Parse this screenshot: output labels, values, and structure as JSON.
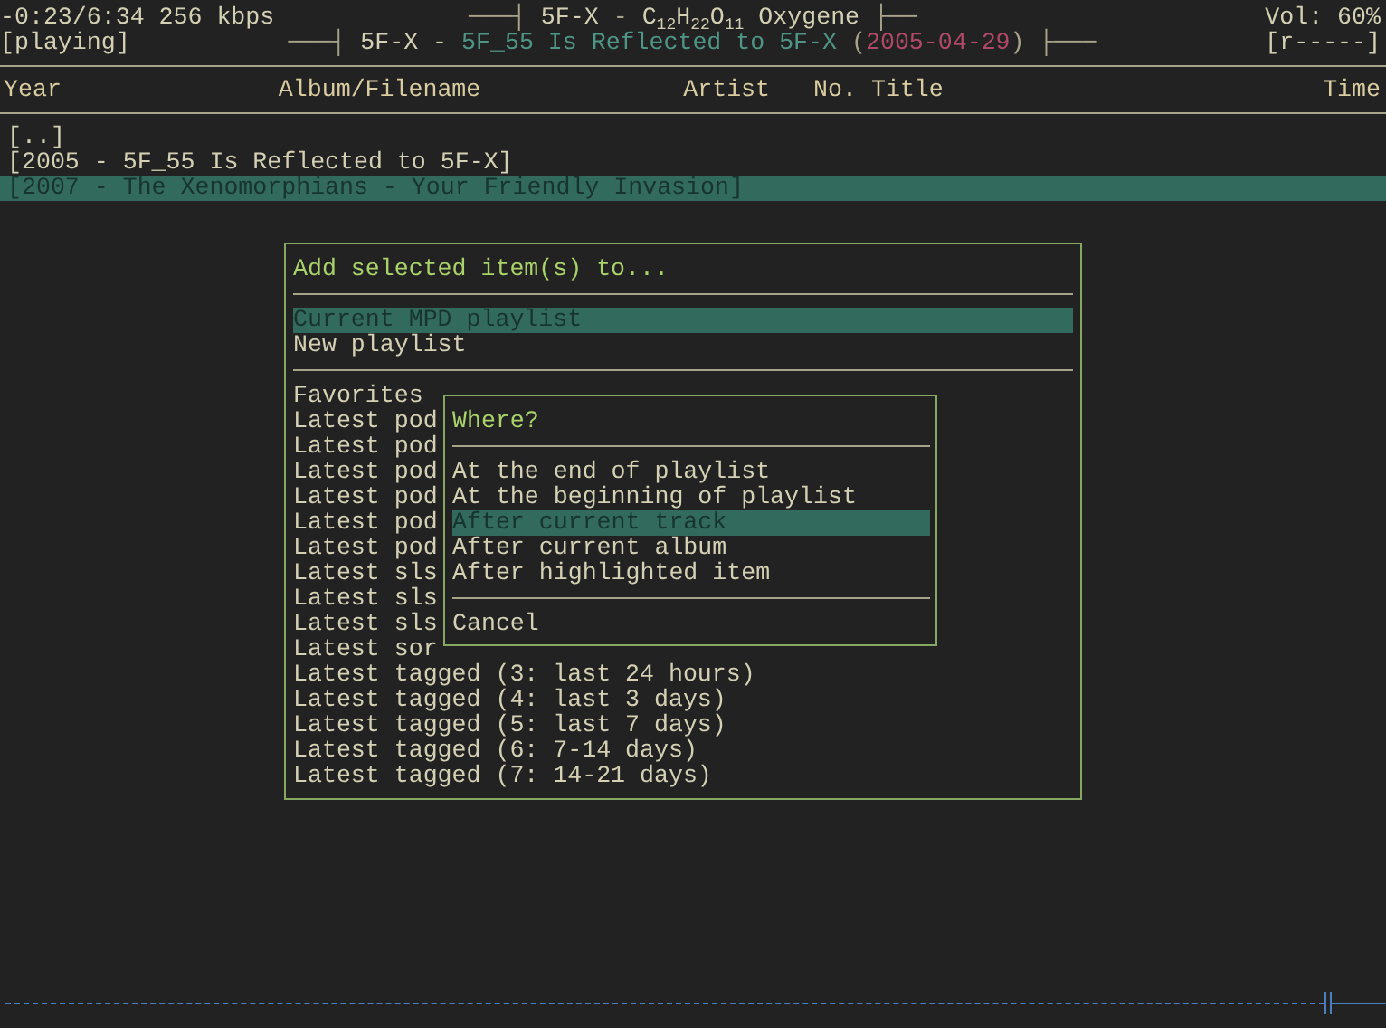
{
  "status": {
    "time": "-0:23/6:34 256 kbps",
    "state": "[playing]",
    "volume": "Vol: 60%",
    "flags": "[r-----]"
  },
  "now_playing": [
    [
      {
        "text": "───┤",
        "kind": "frame"
      },
      {
        "text": "5F-X",
        "kind": "plain"
      },
      {
        "text": "-",
        "kind": "frame"
      },
      {
        "text": "C$_{12}$H$_{22}$O$_{11}$ Oxygene",
        "kind": "plain"
      },
      {
        "text": "├──",
        "kind": "frame"
      }
    ],
    [
      {
        "text": "───┤",
        "kind": "frame"
      },
      {
        "text": "5F-X",
        "kind": "plain"
      },
      {
        "text": "-",
        "kind": "plain"
      },
      {
        "text": "5F_55 Is Reflected to 5F-X",
        "kind": "album"
      },
      {
        "text": "2005-04-29",
        "open": "(",
        "close": ")",
        "kind": "date"
      },
      {
        "text": "├───",
        "kind": "frame"
      }
    ]
  ],
  "columns": [
    "Year",
    "Album/Filename",
    "Artist",
    "No.",
    "Title",
    "Time"
  ],
  "rows": [
    {
      "label": "[..]",
      "selected": false
    },
    {
      "label": "[2005 - 5F_55 Is Reflected to 5F-X]",
      "selected": false
    },
    {
      "label": "[2007 - The Xenomorphians - Your Friendly Invasion]",
      "selected": true
    }
  ],
  "dialog": {
    "title": "Add selected item(s) to...",
    "targets": [
      {
        "label": "Current MPD playlist",
        "selected": true
      },
      {
        "label": "New playlist",
        "selected": false
      }
    ],
    "playlists": [
      "Favorites",
      "Latest pod",
      "Latest pod",
      "Latest pod",
      "Latest pod",
      "Latest pod",
      "Latest pod",
      "Latest sls",
      "Latest sls",
      "Latest sls",
      "Latest sor",
      "Latest tagged (3: last 24 hours)",
      "Latest tagged (4: last 3 days)",
      "Latest tagged (5: last 7 days)",
      "Latest tagged (6: 7-14 days)",
      "Latest tagged (7: 14-21 days)"
    ]
  },
  "where": {
    "title": "Where?",
    "options": [
      {
        "label": "At the end of playlist",
        "selected": false
      },
      {
        "label": "At the beginning of playlist",
        "selected": false
      },
      {
        "label": "After current track",
        "selected": true
      },
      {
        "label": "After current album",
        "selected": false
      },
      {
        "label": "After highlighted item",
        "selected": false
      }
    ],
    "cancel": "Cancel"
  },
  "progress": {
    "level": 0.955
  }
}
